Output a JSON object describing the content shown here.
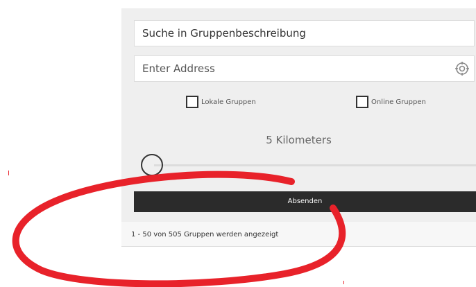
{
  "search": {
    "placeholder": "Suche in Gruppenbeschreibung"
  },
  "address": {
    "placeholder": "Enter Address",
    "locate_icon": "crosshair-locate-icon"
  },
  "filters": {
    "local_label": "Lokale Gruppen",
    "online_label": "Online Gruppen"
  },
  "distance": {
    "label": "5 Kilometers",
    "value_km": 5
  },
  "submit": {
    "label": "Absenden"
  },
  "results": {
    "text": "1 - 50 von 505 Gruppen werden angezeigt"
  },
  "annotation": {
    "color": "#e8222a",
    "shape": "ellipse"
  },
  "colors": {
    "accent_dark": "#2b2b2b",
    "panel_bg": "#efefef"
  }
}
